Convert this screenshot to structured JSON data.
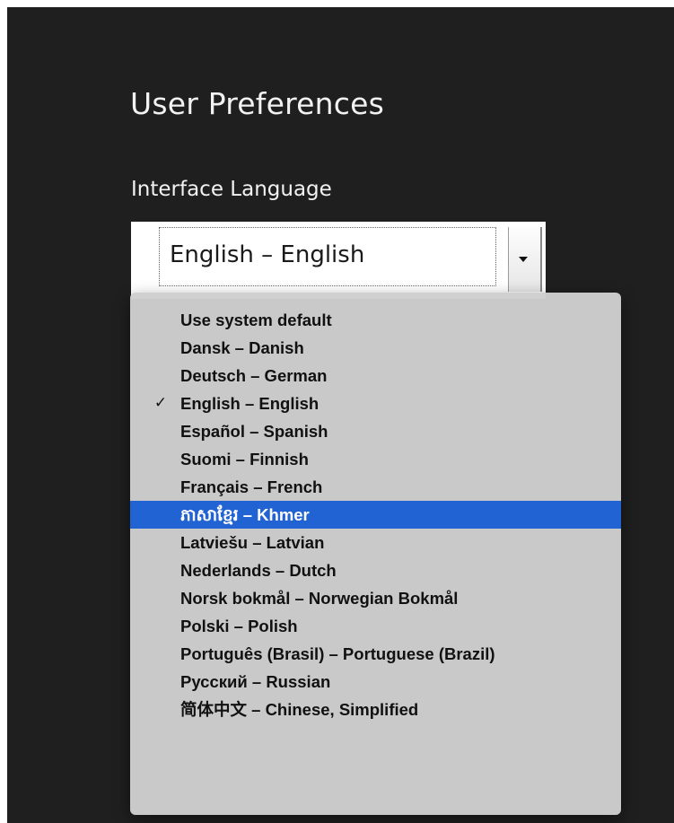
{
  "page": {
    "title": "User Preferences"
  },
  "language_field": {
    "label": "Interface Language",
    "selected_value": "English – English"
  },
  "dropdown": {
    "check_glyph": "✓",
    "checked_index": 3,
    "highlighted_index": 7,
    "highlight_color": "#2163d3",
    "options": [
      "Use system default",
      "Dansk – Danish",
      "Deutsch – German",
      "English – English",
      "Español – Spanish",
      "Suomi – Finnish",
      "Français – French",
      "ភាសាខ្មែរ – Khmer",
      "Latviešu – Latvian",
      "Nederlands – Dutch",
      "Norsk bokmål – Norwegian Bokmål",
      "Polski – Polish",
      "Português (Brasil) – Portuguese (Brazil)",
      "Русский – Russian",
      "简体中文 – Chinese, Simplified"
    ]
  }
}
